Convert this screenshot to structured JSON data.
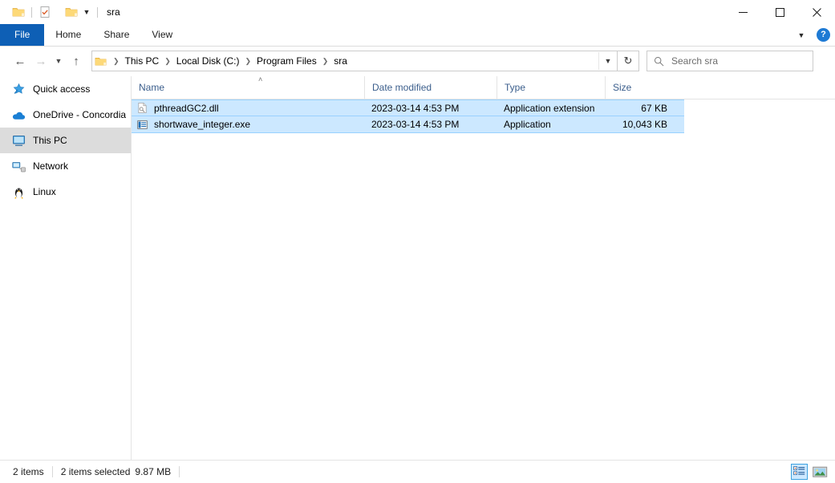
{
  "window": {
    "title": "sra",
    "quick_access": [
      {
        "name": "folder-icon",
        "label": "Folder"
      },
      {
        "name": "properties-icon",
        "label": "Properties"
      },
      {
        "name": "new-folder-icon",
        "label": "New folder"
      }
    ],
    "customize_qat_label": "Customize Quick Access Toolbar",
    "controls": {
      "minimize": "─",
      "maximize": "☐",
      "close": "✕"
    }
  },
  "ribbon": {
    "tabs": [
      {
        "label": "File",
        "active": true
      },
      {
        "label": "Home",
        "active": false
      },
      {
        "label": "Share",
        "active": false
      },
      {
        "label": "View",
        "active": false
      }
    ],
    "expand_chevron": "ⱟ",
    "help_label": "?"
  },
  "addressbar": {
    "back_icon": "←",
    "forward_icon": "→",
    "recent_icon": "ⱟ",
    "up_icon": "↑",
    "dropdown_icon": "ⱟ",
    "refresh_icon": "↻",
    "separator": "❯",
    "breadcrumbs": [
      "This PC",
      "Local Disk (C:)",
      "Program Files",
      "sra"
    ]
  },
  "search": {
    "placeholder": "Search sra"
  },
  "sidebar": {
    "items": [
      {
        "label": "Quick access",
        "icon": "star-pin-icon",
        "selected": false
      },
      {
        "label": "OneDrive - Concordia",
        "icon": "cloud-icon",
        "selected": false
      },
      {
        "label": "This PC",
        "icon": "monitor-icon",
        "selected": true
      },
      {
        "label": "Network",
        "icon": "network-icon",
        "selected": false
      },
      {
        "label": "Linux",
        "icon": "penguin-icon",
        "selected": false
      }
    ]
  },
  "filelist": {
    "columns": [
      {
        "label": "Name",
        "sorted": true,
        "sort_caret": "˄"
      },
      {
        "label": "Date modified",
        "sorted": false
      },
      {
        "label": "Type",
        "sorted": false
      },
      {
        "label": "Size",
        "sorted": false
      }
    ],
    "rows": [
      {
        "name": "pthreadGC2.dll",
        "date": "2023-03-14 4:53 PM",
        "type": "Application extension",
        "size": "67 KB",
        "icon": "dll-file-icon",
        "selected": true
      },
      {
        "name": "shortwave_integer.exe",
        "date": "2023-03-14 4:53 PM",
        "type": "Application",
        "size": "10,043 KB",
        "icon": "exe-file-icon",
        "selected": true
      }
    ]
  },
  "statusbar": {
    "item_count": "2 items",
    "selection_count": "2 items selected",
    "selection_size": "9.87 MB",
    "views": [
      {
        "name": "details-view",
        "active": true
      },
      {
        "name": "large-icons-view",
        "active": false
      }
    ]
  },
  "colors": {
    "accent": "#0e5fb5",
    "selection": "#cce8ff",
    "selection_border": "#99d1ff",
    "header_text": "#3b5e8c",
    "sidebar_selected": "#dcdcdc"
  }
}
